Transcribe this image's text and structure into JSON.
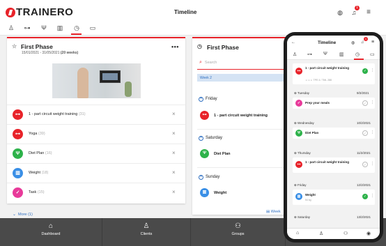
{
  "header": {
    "logo": "TRAINERO",
    "title": "Timeline",
    "notification_count": "1",
    "icons": [
      "globe-icon",
      "bell-icon",
      "menu-icon"
    ]
  },
  "top_nav": {
    "icons": [
      "user-icon",
      "dumbbell-icon",
      "nutrition-icon",
      "chart-icon",
      "timeline-icon",
      "chat-icon"
    ],
    "active": "timeline-icon"
  },
  "phase_card": {
    "title": "First Phase",
    "date_range": "15/01/2021 - 31/05/2021",
    "weeks": "(20 weeks)",
    "items": [
      {
        "label": "1 - part circuit weight training",
        "count": "(31)",
        "color": "#e8232a",
        "icon": "dumbbell-icon"
      },
      {
        "label": "Yoga",
        "count": "(39)",
        "color": "#e8232a",
        "icon": "dumbbell-icon"
      },
      {
        "label": "Diet Plan",
        "count": "(16)",
        "color": "#2db24a",
        "icon": "nutrition-icon"
      },
      {
        "label": "Weight",
        "count": "(18)",
        "color": "#3a8fe6",
        "icon": "chart-icon"
      },
      {
        "label": "Task",
        "count": "(15)",
        "color": "#e83a9a",
        "icon": "task-icon"
      }
    ],
    "more_label": "More (1)"
  },
  "timeline_card": {
    "title": "First Phase",
    "search_placeholder": "Search",
    "week_label": "Week 2",
    "entries": [
      {
        "day": "Friday",
        "label": "1 - part circuit weight training",
        "color": "#e8232a"
      },
      {
        "day": "Saturday",
        "label": "Diet Plan",
        "color": "#2db24a"
      },
      {
        "day": "Sunday",
        "label": "Weight",
        "color": "#3a8fe6"
      }
    ],
    "week_link": "Week"
  },
  "bottom_nav": [
    {
      "label": "Dashboard",
      "icon": "home-icon"
    },
    {
      "label": "Clients",
      "icon": "user-icon"
    },
    {
      "label": "Groups",
      "icon": "group-icon"
    }
  ],
  "phone": {
    "title": "Timeline",
    "notification_count": "1",
    "top_entry": {
      "label": "1 - part circuit weight training",
      "sub": "TPE 4 / TML 288"
    },
    "days": [
      {
        "day": "Tuesday",
        "date": "9/2/2021",
        "label": "Prep your meals",
        "color": "#e83a9a",
        "status": "todo"
      },
      {
        "day": "Wednesday",
        "date": "10/2/2021",
        "label": "Diet Plan",
        "color": "#2db24a",
        "status": "todo"
      },
      {
        "day": "Thursday",
        "date": "11/2/2021",
        "label": "1 - part circuit weight training",
        "color": "#e8232a",
        "status": "todo"
      },
      {
        "day": "Friday",
        "date": "12/2/2021",
        "label": "Weight",
        "sub": "54 kg",
        "color": "#3a8fe6",
        "status": "done"
      },
      {
        "day": "Saturday",
        "date": "13/2/2021",
        "label": "",
        "color": "",
        "status": ""
      }
    ]
  }
}
